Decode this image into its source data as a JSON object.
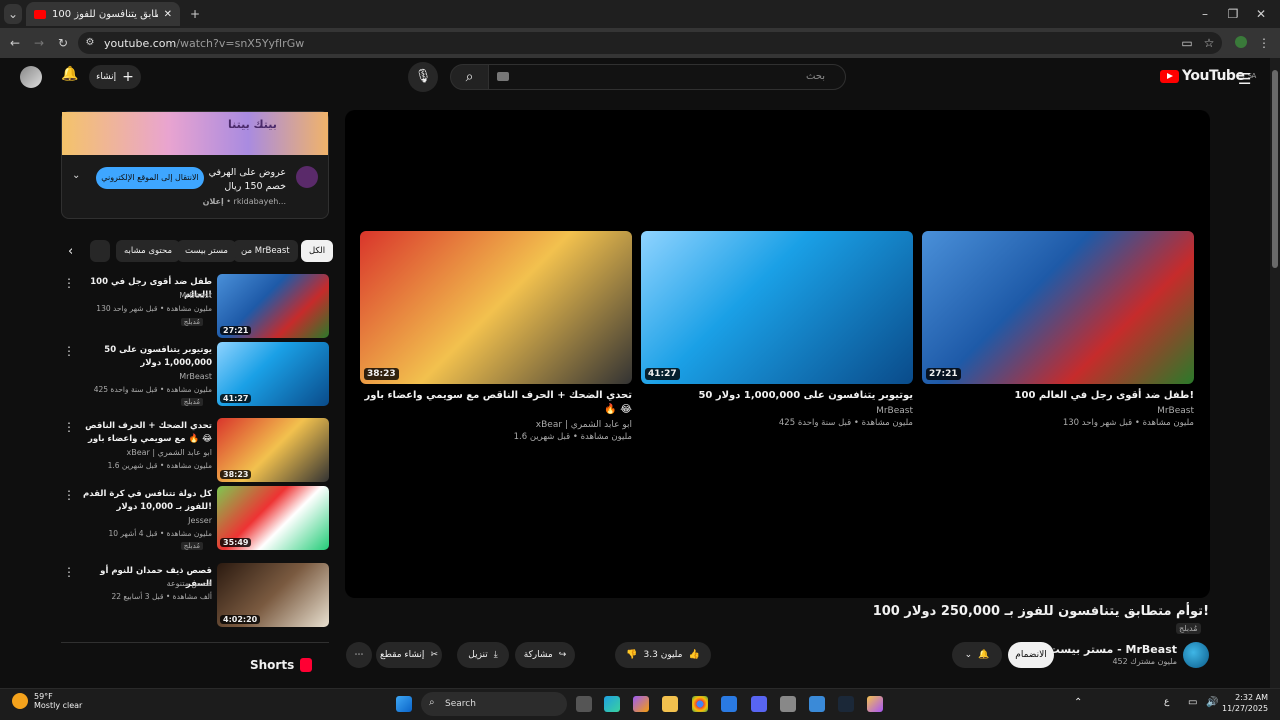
{
  "browser": {
    "tab_title": "100 توأم متطابق يتنافسون للفوز",
    "url_host": "youtube.com",
    "url_path": "/watch?v=snX5YyfIrGw"
  },
  "header": {
    "search_placeholder": "بحث",
    "create_label": "إنشاء",
    "logo_text": "YouTube",
    "region": "SA"
  },
  "ad": {
    "title": "عروض على الهرفي خصم 150 ريال",
    "sponsor": "إعلان",
    "domain": "rkidabayeh...",
    "cta": "الانتقال إلى الموقع الإلكتروني",
    "banner_text": "بيتك بيتنا"
  },
  "chips": [
    "الكل",
    "من MrBeast",
    "مستر بيست",
    "محتوى مشابه"
  ],
  "player_cards": [
    {
      "title": "100 طفل ضد أقوى رجل في العالم!",
      "channel": "MrBeast",
      "meta": "130 مليون مشاهدة • قبل شهر واحد",
      "duration": "27:21"
    },
    {
      "title": "50 يوتيوبر يتنافسون على 1,000,000 دولار",
      "channel": "MrBeast",
      "meta": "425 مليون مشاهدة • قبل سنة واحدة",
      "duration": "41:27"
    },
    {
      "title": "تحدي الضحك + الحرف الناقص مع سويمي واعضاء باور 🔥 😂",
      "channel": "xBear | ابو عابد الشمري",
      "meta": "1.6 مليون مشاهدة • قبل شهرين",
      "duration": "38:23"
    }
  ],
  "video": {
    "title": "100 توأم متطابق يتنافسون للفوز بـ 250,000 دولار!",
    "badge": "مُدبلج",
    "channel_name": "مستر بيست - MrBeast",
    "subs": "452 مليون مشترك",
    "join_label": "الانضمام",
    "likes": "3.3 مليون",
    "share_label": "مشاركة",
    "download_label": "تنزيل",
    "clip_label": "إنشاء مقطع"
  },
  "sidebar": [
    {
      "title": "100 طفل ضد أقوى رجل في العالم!",
      "channel": "MrBeast",
      "meta": "130 مليون مشاهدة • قبل شهر واحد",
      "badge": "مُدبلج",
      "duration": "27:21"
    },
    {
      "title": "50 يوتيوبر يتنافسون على 1,000,000 دولار",
      "channel": "MrBeast",
      "meta": "425 مليون مشاهدة • قبل سنة واحدة",
      "badge": "مُدبلج",
      "duration": "41:27"
    },
    {
      "title": "تحدي الضحك + الحرف الناقص مع سويمي واعضاء باور 🔥 😂",
      "channel": "xBear | ابو عابد الشمري",
      "meta": "1.6 مليون مشاهدة • قبل شهرين",
      "badge": "",
      "duration": "38:23"
    },
    {
      "title": "كل دولة تتنافس في كرة القدم للفوز بـ 10,000 دولار!",
      "channel": "Jesser",
      "meta": "10 مليون مشاهدة • قبل 4 أشهر",
      "badge": "مُدبلج",
      "duration": "35:49"
    },
    {
      "title": "قصص ذيف حمدان للنوم أو السفر",
      "channel": "قصص متنوعة",
      "meta": "22 ألف مشاهدة • قبل 3 أسابيع",
      "badge": "",
      "duration": "4:02:20"
    }
  ],
  "shorts_label": "Shorts",
  "taskbar": {
    "temp": "59°F",
    "weather": "Mostly clear",
    "search": "Search",
    "time": "2:32 AM",
    "date": "11/27/2025",
    "lang": "ع"
  }
}
